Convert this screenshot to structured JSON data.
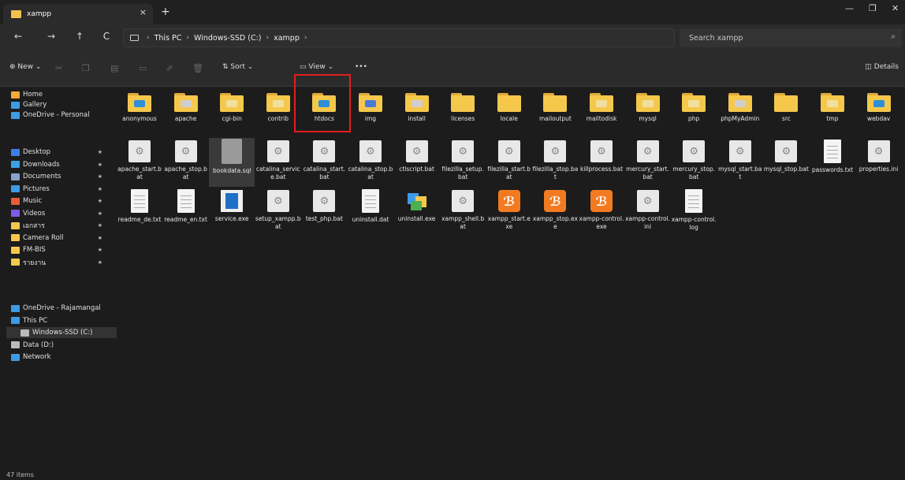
{
  "window": {
    "tab_title": "xampp",
    "tab_close": "×",
    "new_tab": "+",
    "minimize": "—",
    "maximize": "❐",
    "close": "✕"
  },
  "nav": {
    "back": "←",
    "forward": "→",
    "up": "↑",
    "refresh": "C",
    "breadcrumbs": [
      "This PC",
      "Windows-SSD (C:)",
      "xampp"
    ],
    "search_placeholder": "Search xampp"
  },
  "toolbar": {
    "new_label": "New",
    "sort_label": "Sort",
    "view_label": "View",
    "more_label": "•••",
    "details_label": "Details"
  },
  "sidebar": {
    "top": [
      {
        "label": "Home",
        "icon": "home-icon",
        "color": "#f2a93a"
      },
      {
        "label": "Gallery",
        "icon": "gallery-icon",
        "color": "#3c9be6"
      },
      {
        "label": "OneDrive - Personal",
        "icon": "cloud-icon",
        "color": "#3c9be6"
      }
    ],
    "pinned": [
      {
        "label": "Desktop",
        "icon": "desktop-icon",
        "color": "#3c7ee6"
      },
      {
        "label": "Downloads",
        "icon": "download-icon",
        "color": "#3ca0e6"
      },
      {
        "label": "Documents",
        "icon": "document-icon",
        "color": "#8aa0c8"
      },
      {
        "label": "Pictures",
        "icon": "pictures-icon",
        "color": "#3c9be6"
      },
      {
        "label": "Music",
        "icon": "music-icon",
        "color": "#e65c3c"
      },
      {
        "label": "Videos",
        "icon": "videos-icon",
        "color": "#7c5ce6"
      },
      {
        "label": "เอกสาร",
        "icon": "folder-icon",
        "color": "#f5c84c"
      },
      {
        "label": "Camera Roll",
        "icon": "folder-icon",
        "color": "#f5c84c"
      },
      {
        "label": "FM-BIS",
        "icon": "folder-icon",
        "color": "#f5c84c"
      },
      {
        "label": "รายงาน",
        "icon": "folder-icon",
        "color": "#f5c84c"
      }
    ],
    "drives": [
      {
        "label": "OneDrive - Rajamangal",
        "icon": "cloud-icon",
        "color": "#3c9be6"
      },
      {
        "label": "This PC",
        "icon": "pc-icon",
        "color": "#3c9be6"
      },
      {
        "label": "Windows-SSD (C:)",
        "icon": "drive-icon",
        "color": "#bbbbbb",
        "selected": true
      },
      {
        "label": "Data (D:)",
        "icon": "drive-icon",
        "color": "#bbbbbb"
      },
      {
        "label": "Network",
        "icon": "network-icon",
        "color": "#3c9be6"
      }
    ]
  },
  "files": [
    {
      "label": "anonymous",
      "type": "folder",
      "mark": "#2f8fd6"
    },
    {
      "label": "apache",
      "type": "folder",
      "mark": "#cfcfcf"
    },
    {
      "label": "cgi-bin",
      "type": "folder",
      "mark": "#f0e0a0"
    },
    {
      "label": "contrib",
      "type": "folder",
      "mark": "#f0e0a0"
    },
    {
      "label": "htdocs",
      "type": "folder",
      "mark": "#2f8fd6"
    },
    {
      "label": "img",
      "type": "folder",
      "mark": "#4a7ad8"
    },
    {
      "label": "install",
      "type": "folder",
      "mark": "#cfcfcf"
    },
    {
      "label": "licenses",
      "type": "folder",
      "mark": ""
    },
    {
      "label": "locale",
      "type": "folder",
      "mark": ""
    },
    {
      "label": "mailoutput",
      "type": "folder",
      "mark": ""
    },
    {
      "label": "mailtodisk",
      "type": "folder",
      "mark": "#f0e0a0"
    },
    {
      "label": "mysql",
      "type": "folder",
      "mark": "#f0e0a0"
    },
    {
      "label": "php",
      "type": "folder",
      "mark": "#f0e0a0"
    },
    {
      "label": "phpMyAdmin",
      "type": "folder",
      "mark": "#cfcfcf"
    },
    {
      "label": "src",
      "type": "folder",
      "mark": ""
    },
    {
      "label": "tmp",
      "type": "folder",
      "mark": "#f0e0a0"
    },
    {
      "label": "webdav",
      "type": "folder",
      "mark": "#2f8fd6"
    },
    {
      "label": "apache_start.bat",
      "type": "gear"
    },
    {
      "label": "apache_stop.bat",
      "type": "gear"
    },
    {
      "label": "bookdata.sql",
      "type": "sql"
    },
    {
      "label": "catalina_service.bat",
      "type": "gear"
    },
    {
      "label": "catalina_start.bat",
      "type": "gear"
    },
    {
      "label": "catalina_stop.bat",
      "type": "gear"
    },
    {
      "label": "ctlscript.bat",
      "type": "gear"
    },
    {
      "label": "filezilla_setup.bat",
      "type": "gear"
    },
    {
      "label": "filezilla_start.bat",
      "type": "gear"
    },
    {
      "label": "filezilla_stop.bat",
      "type": "gear"
    },
    {
      "label": "killprocess.bat",
      "type": "gear"
    },
    {
      "label": "mercury_start.bat",
      "type": "gear"
    },
    {
      "label": "mercury_stop.bat",
      "type": "gear"
    },
    {
      "label": "mysql_start.bat",
      "type": "gear"
    },
    {
      "label": "mysql_stop.bat",
      "type": "gear"
    },
    {
      "label": "passwords.txt",
      "type": "doc"
    },
    {
      "label": "properties.ini",
      "type": "gear"
    },
    {
      "label": "readme_de.txt",
      "type": "doc"
    },
    {
      "label": "readme_en.txt",
      "type": "doc"
    },
    {
      "label": "service.exe",
      "type": "exe"
    },
    {
      "label": "setup_xampp.bat",
      "type": "gear"
    },
    {
      "label": "test_php.bat",
      "type": "gear"
    },
    {
      "label": "uninstall.dat",
      "type": "doc"
    },
    {
      "label": "uninstall.exe",
      "type": "multi"
    },
    {
      "label": "xampp_shell.bat",
      "type": "gear"
    },
    {
      "label": "xampp_start.exe",
      "type": "xampp"
    },
    {
      "label": "xampp_stop.exe",
      "type": "xampp"
    },
    {
      "label": "xampp-control.exe",
      "type": "xampp"
    },
    {
      "label": "xampp-control.ini",
      "type": "gear"
    },
    {
      "label": "xampp-control.log",
      "type": "doc"
    }
  ],
  "status": {
    "item_count": "47 items"
  }
}
